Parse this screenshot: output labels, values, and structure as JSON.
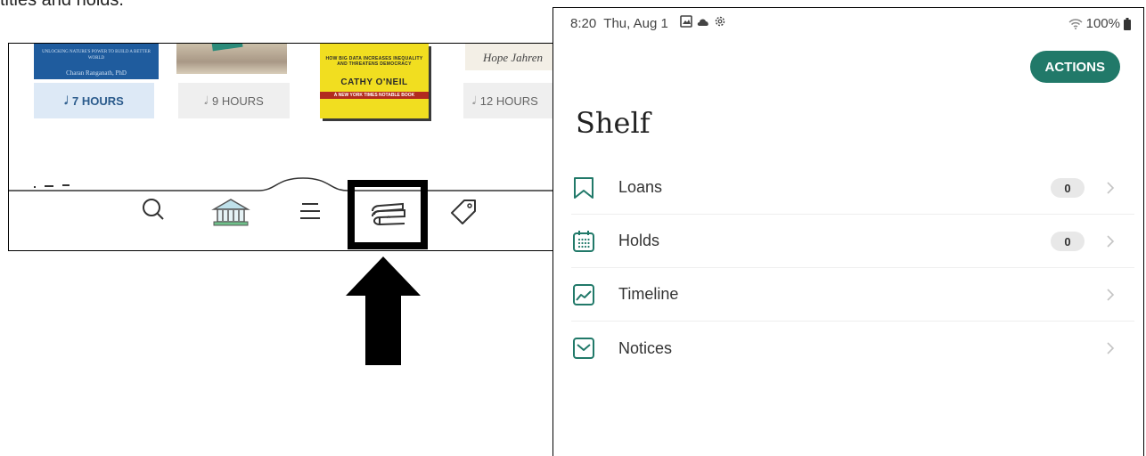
{
  "caption": "titles and holds.",
  "left_panel": {
    "book1": {
      "cover_text": "UNLOCKING NATURE'S POWER TO BUILD A BETTER WORLD",
      "author": "Charan Ranganath, PhD",
      "hours": "7 HOURS"
    },
    "book2": {
      "hours": "9 HOURS"
    },
    "book3": {
      "cover_small": "HOW BIG DATA INCREASES INEQUALITY AND THREATENS DEMOCRACY",
      "author": "CATHY O'NEIL",
      "subtitle": "A NEW YORK TIMES NOTABLE BOOK"
    },
    "book4": {
      "cover_author": "Hope Jahren",
      "hours": "12 HOURS"
    },
    "tabs": [
      "search-icon",
      "library-icon",
      "menu-icon",
      "shelf-icon",
      "tag-icon"
    ],
    "highlighted_tab": "shelf-icon"
  },
  "status_bar": {
    "time": "8:20",
    "date": "Thu, Aug 1",
    "battery": "100%"
  },
  "header": {
    "actions_label": "ACTIONS"
  },
  "page_title": "Shelf",
  "menu": [
    {
      "label": "Loans",
      "icon": "bookmark-icon",
      "count": "0"
    },
    {
      "label": "Holds",
      "icon": "calendar-icon",
      "count": "0"
    },
    {
      "label": "Timeline",
      "icon": "timeline-icon"
    },
    {
      "label": "Notices",
      "icon": "envelope-icon"
    }
  ],
  "colors": {
    "accent": "#217969",
    "icon_teal": "#217969"
  }
}
